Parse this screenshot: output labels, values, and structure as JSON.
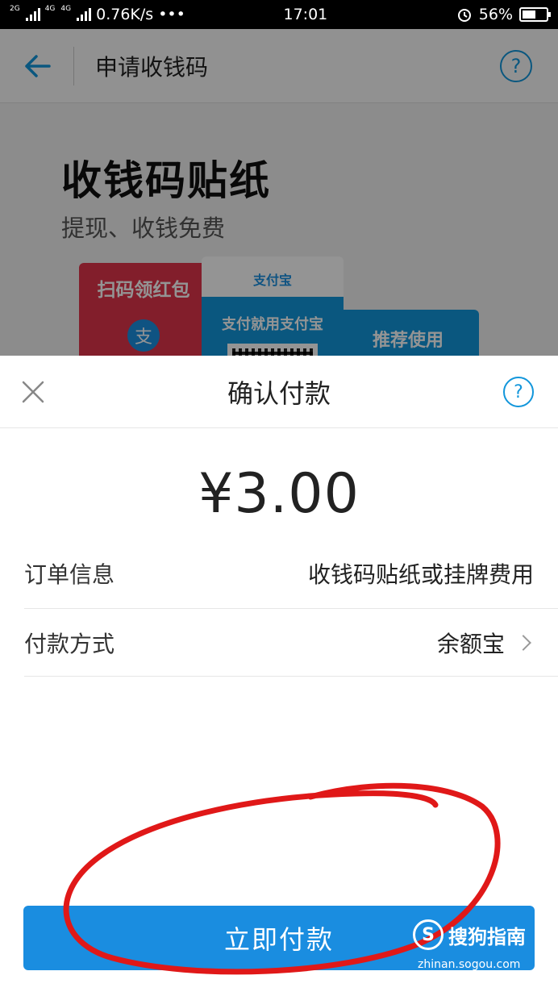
{
  "status_bar": {
    "network_tags": [
      "2G",
      "4G",
      "4G"
    ],
    "speed": "0.76K/s",
    "dots": "•••",
    "time": "17:01",
    "battery": "56%",
    "battery_level": 0.56
  },
  "background_page": {
    "title": "申请收钱码",
    "help": "?",
    "hero_title": "收钱码贴纸",
    "hero_subtitle": "提现、收钱免费",
    "red_sticker_text": "扫码领红包",
    "red_sticker_avatar": "支",
    "white_sticker_logo": "支付宝",
    "white_sticker_text": "支付就用支付宝",
    "blue_sticker_text": "推荐使用"
  },
  "sheet": {
    "title": "确认付款",
    "help": "?",
    "amount": "¥3.00",
    "order_label": "订单信息",
    "order_value": "收钱码贴纸或挂牌费用",
    "method_label": "付款方式",
    "method_value": "余额宝",
    "pay_button": "立即付款"
  },
  "watermark": {
    "logo": "S",
    "text": "搜狗指南",
    "url": "zhinan.sogou.com"
  },
  "colors": {
    "accent": "#1a8de0",
    "annotation": "#e01818"
  }
}
